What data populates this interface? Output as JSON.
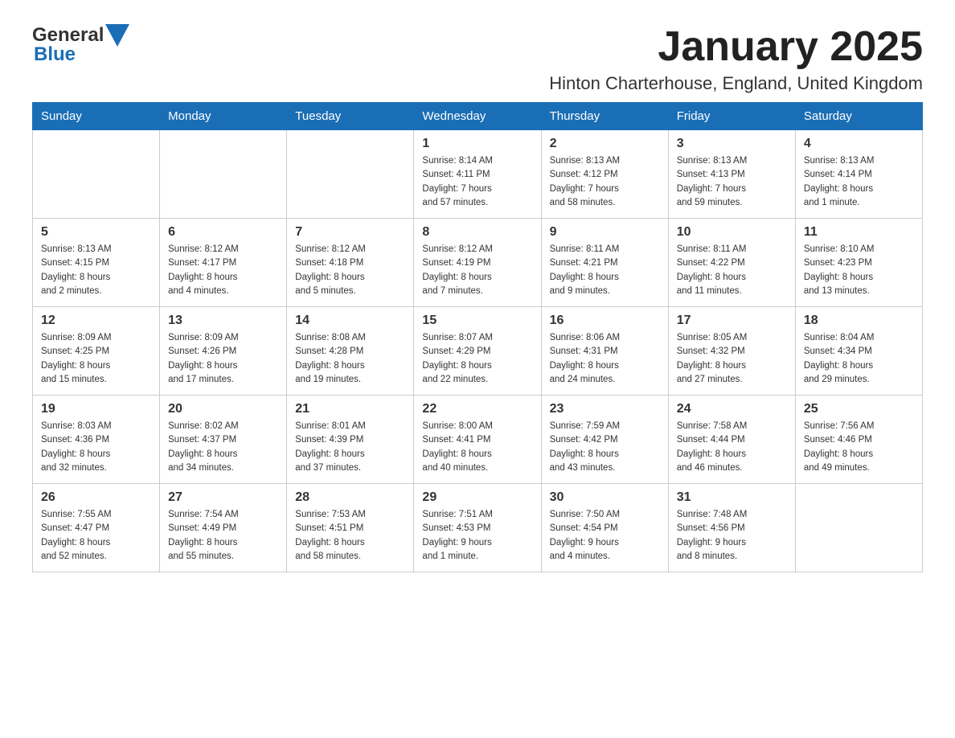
{
  "header": {
    "logo_general": "General",
    "logo_blue": "Blue",
    "month_title": "January 2025",
    "location": "Hinton Charterhouse, England, United Kingdom"
  },
  "weekdays": [
    "Sunday",
    "Monday",
    "Tuesday",
    "Wednesday",
    "Thursday",
    "Friday",
    "Saturday"
  ],
  "weeks": [
    [
      {
        "day": "",
        "info": ""
      },
      {
        "day": "",
        "info": ""
      },
      {
        "day": "",
        "info": ""
      },
      {
        "day": "1",
        "info": "Sunrise: 8:14 AM\nSunset: 4:11 PM\nDaylight: 7 hours\nand 57 minutes."
      },
      {
        "day": "2",
        "info": "Sunrise: 8:13 AM\nSunset: 4:12 PM\nDaylight: 7 hours\nand 58 minutes."
      },
      {
        "day": "3",
        "info": "Sunrise: 8:13 AM\nSunset: 4:13 PM\nDaylight: 7 hours\nand 59 minutes."
      },
      {
        "day": "4",
        "info": "Sunrise: 8:13 AM\nSunset: 4:14 PM\nDaylight: 8 hours\nand 1 minute."
      }
    ],
    [
      {
        "day": "5",
        "info": "Sunrise: 8:13 AM\nSunset: 4:15 PM\nDaylight: 8 hours\nand 2 minutes."
      },
      {
        "day": "6",
        "info": "Sunrise: 8:12 AM\nSunset: 4:17 PM\nDaylight: 8 hours\nand 4 minutes."
      },
      {
        "day": "7",
        "info": "Sunrise: 8:12 AM\nSunset: 4:18 PM\nDaylight: 8 hours\nand 5 minutes."
      },
      {
        "day": "8",
        "info": "Sunrise: 8:12 AM\nSunset: 4:19 PM\nDaylight: 8 hours\nand 7 minutes."
      },
      {
        "day": "9",
        "info": "Sunrise: 8:11 AM\nSunset: 4:21 PM\nDaylight: 8 hours\nand 9 minutes."
      },
      {
        "day": "10",
        "info": "Sunrise: 8:11 AM\nSunset: 4:22 PM\nDaylight: 8 hours\nand 11 minutes."
      },
      {
        "day": "11",
        "info": "Sunrise: 8:10 AM\nSunset: 4:23 PM\nDaylight: 8 hours\nand 13 minutes."
      }
    ],
    [
      {
        "day": "12",
        "info": "Sunrise: 8:09 AM\nSunset: 4:25 PM\nDaylight: 8 hours\nand 15 minutes."
      },
      {
        "day": "13",
        "info": "Sunrise: 8:09 AM\nSunset: 4:26 PM\nDaylight: 8 hours\nand 17 minutes."
      },
      {
        "day": "14",
        "info": "Sunrise: 8:08 AM\nSunset: 4:28 PM\nDaylight: 8 hours\nand 19 minutes."
      },
      {
        "day": "15",
        "info": "Sunrise: 8:07 AM\nSunset: 4:29 PM\nDaylight: 8 hours\nand 22 minutes."
      },
      {
        "day": "16",
        "info": "Sunrise: 8:06 AM\nSunset: 4:31 PM\nDaylight: 8 hours\nand 24 minutes."
      },
      {
        "day": "17",
        "info": "Sunrise: 8:05 AM\nSunset: 4:32 PM\nDaylight: 8 hours\nand 27 minutes."
      },
      {
        "day": "18",
        "info": "Sunrise: 8:04 AM\nSunset: 4:34 PM\nDaylight: 8 hours\nand 29 minutes."
      }
    ],
    [
      {
        "day": "19",
        "info": "Sunrise: 8:03 AM\nSunset: 4:36 PM\nDaylight: 8 hours\nand 32 minutes."
      },
      {
        "day": "20",
        "info": "Sunrise: 8:02 AM\nSunset: 4:37 PM\nDaylight: 8 hours\nand 34 minutes."
      },
      {
        "day": "21",
        "info": "Sunrise: 8:01 AM\nSunset: 4:39 PM\nDaylight: 8 hours\nand 37 minutes."
      },
      {
        "day": "22",
        "info": "Sunrise: 8:00 AM\nSunset: 4:41 PM\nDaylight: 8 hours\nand 40 minutes."
      },
      {
        "day": "23",
        "info": "Sunrise: 7:59 AM\nSunset: 4:42 PM\nDaylight: 8 hours\nand 43 minutes."
      },
      {
        "day": "24",
        "info": "Sunrise: 7:58 AM\nSunset: 4:44 PM\nDaylight: 8 hours\nand 46 minutes."
      },
      {
        "day": "25",
        "info": "Sunrise: 7:56 AM\nSunset: 4:46 PM\nDaylight: 8 hours\nand 49 minutes."
      }
    ],
    [
      {
        "day": "26",
        "info": "Sunrise: 7:55 AM\nSunset: 4:47 PM\nDaylight: 8 hours\nand 52 minutes."
      },
      {
        "day": "27",
        "info": "Sunrise: 7:54 AM\nSunset: 4:49 PM\nDaylight: 8 hours\nand 55 minutes."
      },
      {
        "day": "28",
        "info": "Sunrise: 7:53 AM\nSunset: 4:51 PM\nDaylight: 8 hours\nand 58 minutes."
      },
      {
        "day": "29",
        "info": "Sunrise: 7:51 AM\nSunset: 4:53 PM\nDaylight: 9 hours\nand 1 minute."
      },
      {
        "day": "30",
        "info": "Sunrise: 7:50 AM\nSunset: 4:54 PM\nDaylight: 9 hours\nand 4 minutes."
      },
      {
        "day": "31",
        "info": "Sunrise: 7:48 AM\nSunset: 4:56 PM\nDaylight: 9 hours\nand 8 minutes."
      },
      {
        "day": "",
        "info": ""
      }
    ]
  ]
}
